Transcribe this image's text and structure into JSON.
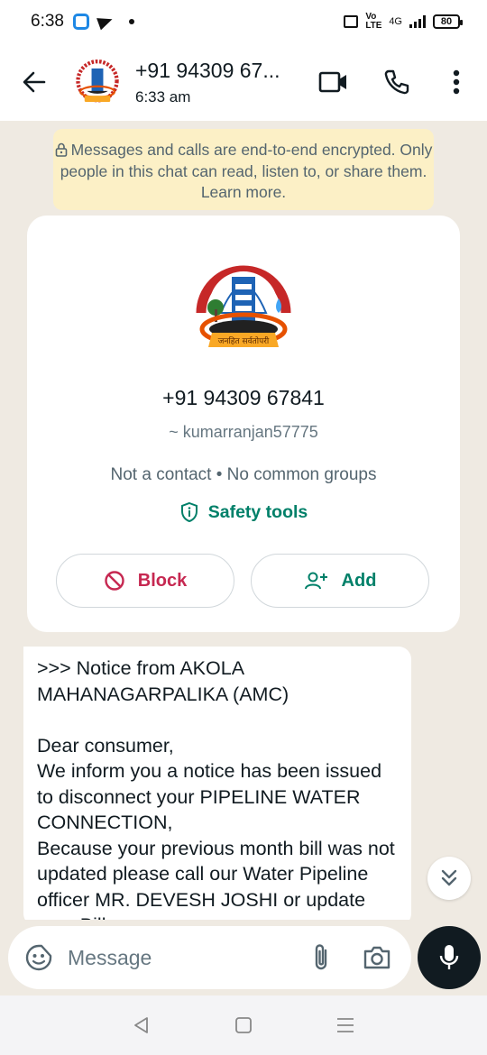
{
  "status_bar": {
    "time": "6:38",
    "network": "4G",
    "volte": "Vo LTE",
    "battery": "80"
  },
  "header": {
    "contact_name": "+91 94309 67...",
    "last_seen": "6:33 am"
  },
  "chat": {
    "encryption_notice": "Messages and calls are end-to-end encrypted. Only people in this chat can read, listen to, or share them. Learn more.",
    "profile_card": {
      "phone": "+91 94309 67841",
      "username": "~ kumarranjan57775",
      "meta": "Not a contact • No common groups",
      "safety_label": "Safety tools",
      "block_label": "Block",
      "add_label": "Add"
    },
    "message_text": ">>> Notice from AKOLA MAHANAGARPALIKA (AMC)\n\nDear consumer,\nWe inform you a notice has been issued to disconnect your PIPELINE WATER CONNECTION,\nBecause your previous month bill was not updated please call our Water Pipeline officer MR. DEVESH JOSHI or update your Bill"
  },
  "input": {
    "placeholder": "Message"
  },
  "logo_text": "जनहित सर्वतोपरी",
  "colors": {
    "wa_green": "#008069",
    "block_red": "#c62851",
    "banner_yellow": "#fcf0c6",
    "chat_bg": "#efeae2"
  },
  "icons": [
    "back-arrow-icon",
    "video-call-icon",
    "phone-icon",
    "more-vertical-icon",
    "lock-icon",
    "shield-icon",
    "block-icon",
    "add-person-icon",
    "double-chevron-down-icon",
    "sticker-icon",
    "paperclip-icon",
    "camera-icon",
    "mic-icon",
    "nav-back-icon",
    "nav-home-icon",
    "nav-menu-icon"
  ]
}
